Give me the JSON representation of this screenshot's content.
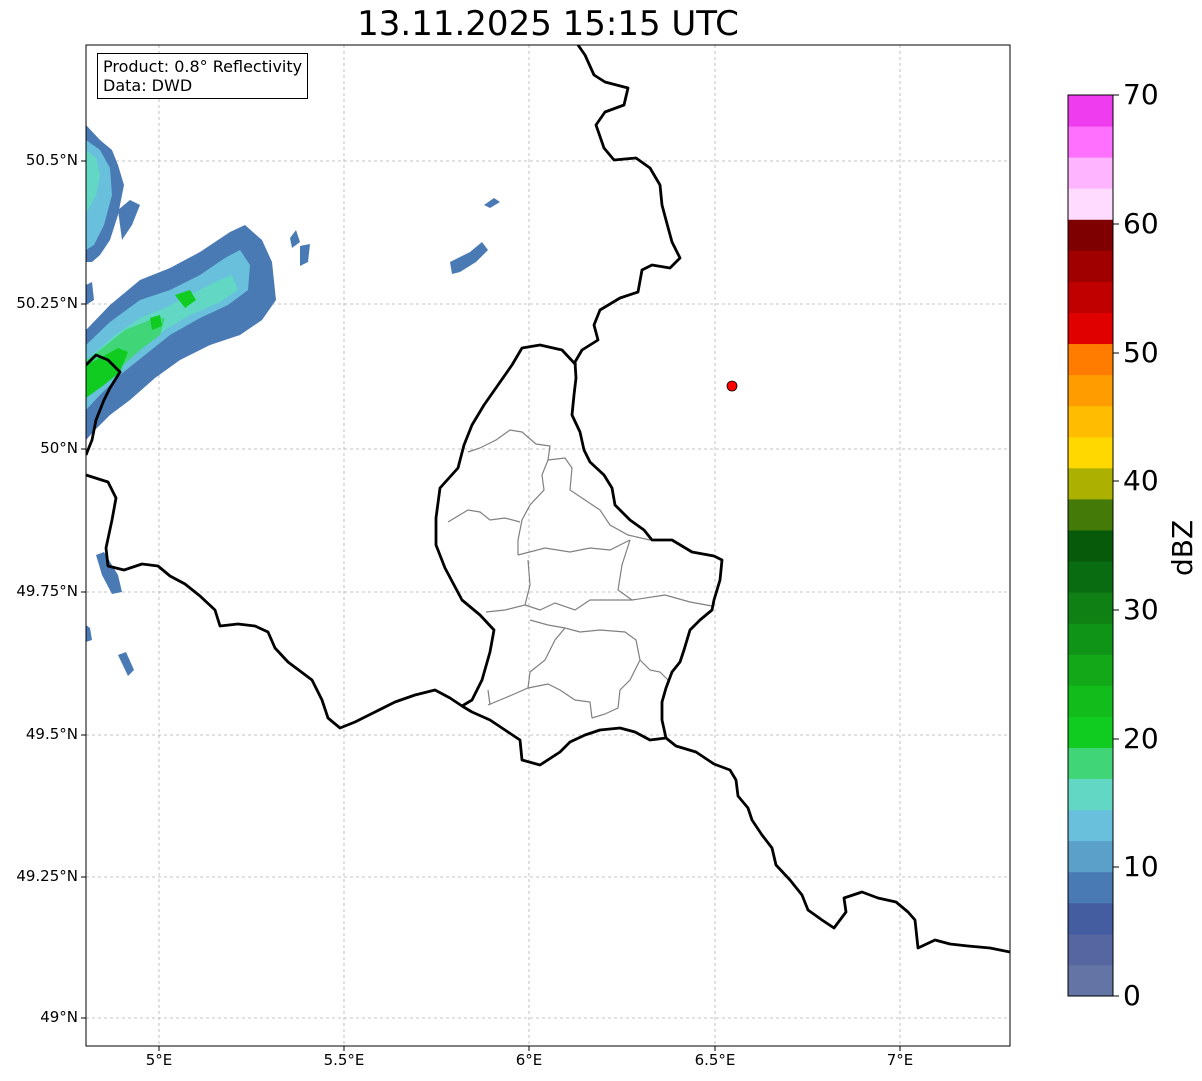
{
  "title": "13.11.2025 15:15 UTC",
  "info": {
    "product_line": "Product: 0.8° Reflectivity",
    "data_line": "Data: DWD"
  },
  "map": {
    "lon_range": [
      4.8,
      7.3
    ],
    "lat_range": [
      48.95,
      50.7
    ],
    "lat_ticks": [
      {
        "value": 50.5,
        "label": "50.5°N"
      },
      {
        "value": 50.25,
        "label": "50.25°N"
      },
      {
        "value": 50.0,
        "label": "50°N"
      },
      {
        "value": 49.75,
        "label": "49.75°N"
      },
      {
        "value": 49.5,
        "label": "49.5°N"
      },
      {
        "value": 49.25,
        "label": "49.25°N"
      },
      {
        "value": 49.0,
        "label": "49°N"
      }
    ],
    "lon_ticks": [
      {
        "value": 5.0,
        "label": "5°E"
      },
      {
        "value": 5.5,
        "label": "5.5°E"
      },
      {
        "value": 6.0,
        "label": "6°E"
      },
      {
        "value": 6.5,
        "label": "6.5°E"
      },
      {
        "value": 7.0,
        "label": "7°E"
      }
    ],
    "radar_site_marker": {
      "lon": 6.55,
      "lat": 50.11,
      "color": "#ff0000"
    },
    "border_color": "#000000",
    "canton_color": "#808080",
    "gridlines": true
  },
  "colorbar": {
    "unit": "dBZ",
    "min": 0,
    "max": 70,
    "ticks": [
      "0",
      "10",
      "20",
      "30",
      "40",
      "50",
      "60",
      "70"
    ],
    "colors": [
      "#6474a4",
      "#5566a0",
      "#445da0",
      "#4a7ab4",
      "#5aa0c8",
      "#68c0dc",
      "#62d8c4",
      "#40d678",
      "#10cc20",
      "#12bc1a",
      "#12a818",
      "#109418",
      "#0e8014",
      "#0a6c10",
      "#065a0a",
      "#447a08",
      "#acb000",
      "#ffd800",
      "#ffbc00",
      "#ff9c00",
      "#ff7c00",
      "#e00000",
      "#c00000",
      "#a00000",
      "#7e0000",
      "#ffdcff",
      "#ffb4ff",
      "#ff70ff",
      "#ee3cee"
    ]
  }
}
